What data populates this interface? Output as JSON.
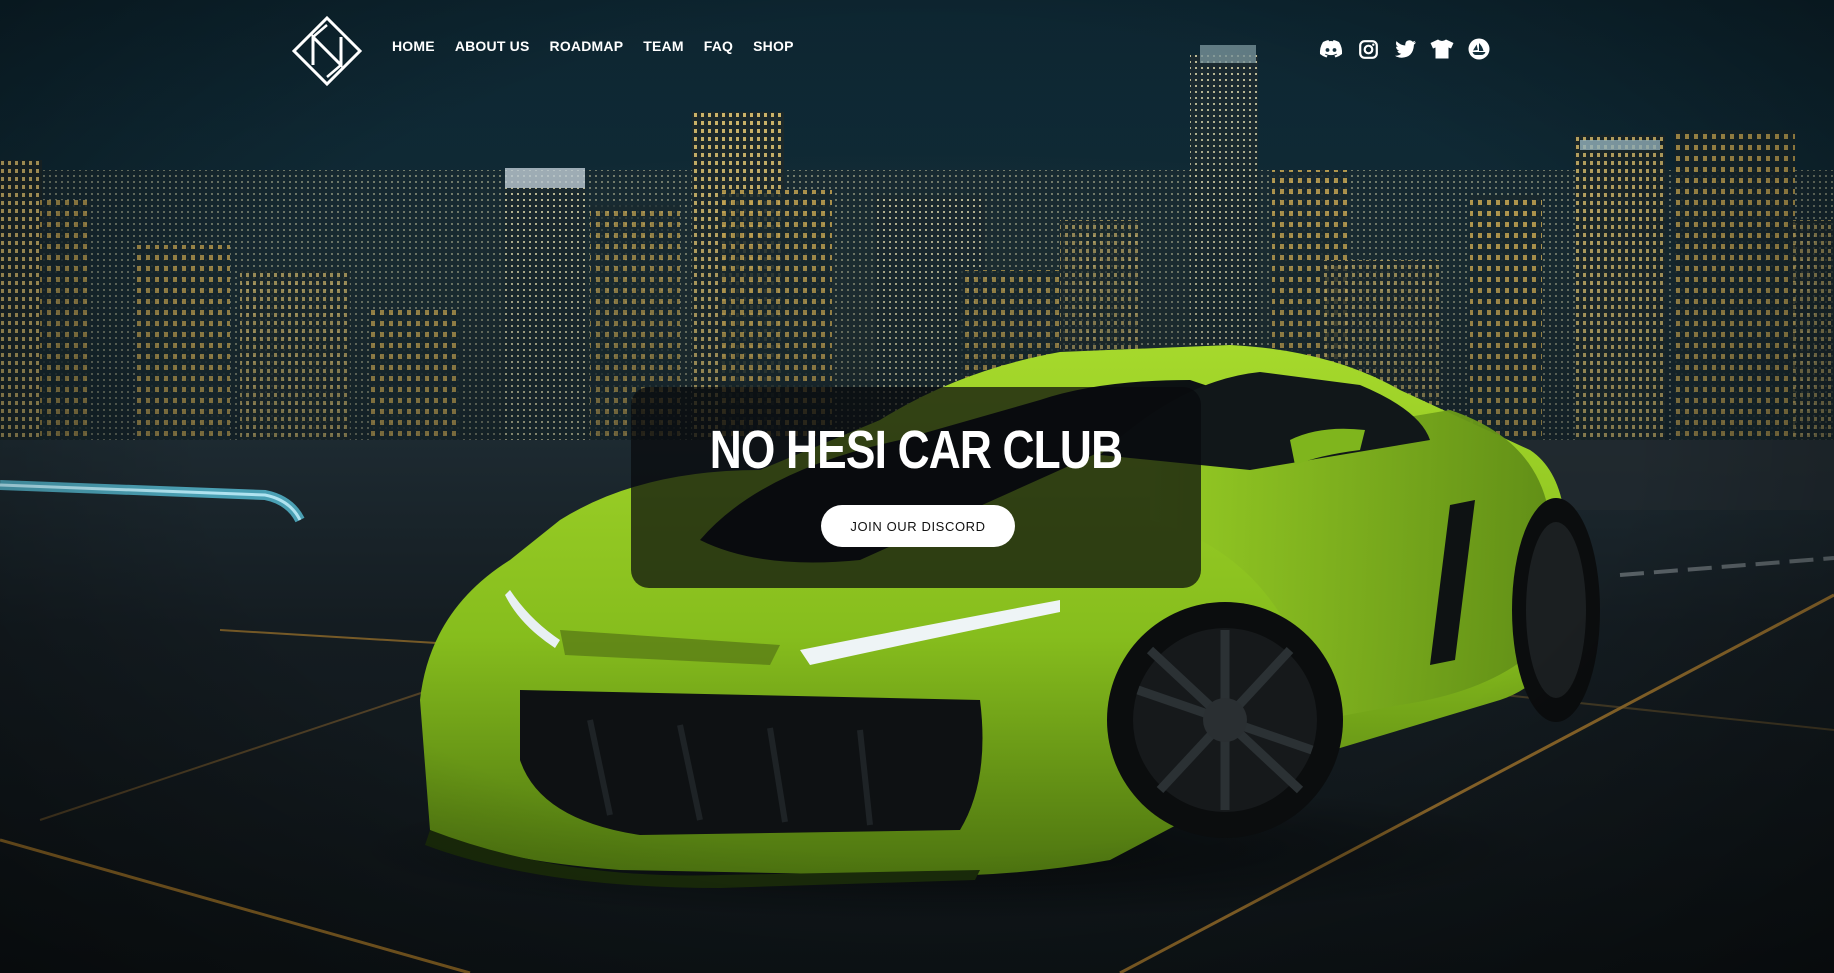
{
  "nav": {
    "items": [
      {
        "label": "HOME"
      },
      {
        "label": "ABOUT US"
      },
      {
        "label": "ROADMAP"
      },
      {
        "label": "TEAM"
      },
      {
        "label": "FAQ"
      },
      {
        "label": "SHOP"
      }
    ]
  },
  "socials": [
    {
      "icon": "discord-icon"
    },
    {
      "icon": "instagram-icon"
    },
    {
      "icon": "twitter-icon"
    },
    {
      "icon": "tshirt-icon"
    },
    {
      "icon": "opensea-icon"
    }
  ],
  "hero": {
    "title": "NO HESI CAR CLUB",
    "cta_label": "JOIN OUR DISCORD"
  },
  "colors": {
    "car": "#8dc21f",
    "text": "#ffffff",
    "card": "#08090c",
    "button": "#ffffff"
  }
}
